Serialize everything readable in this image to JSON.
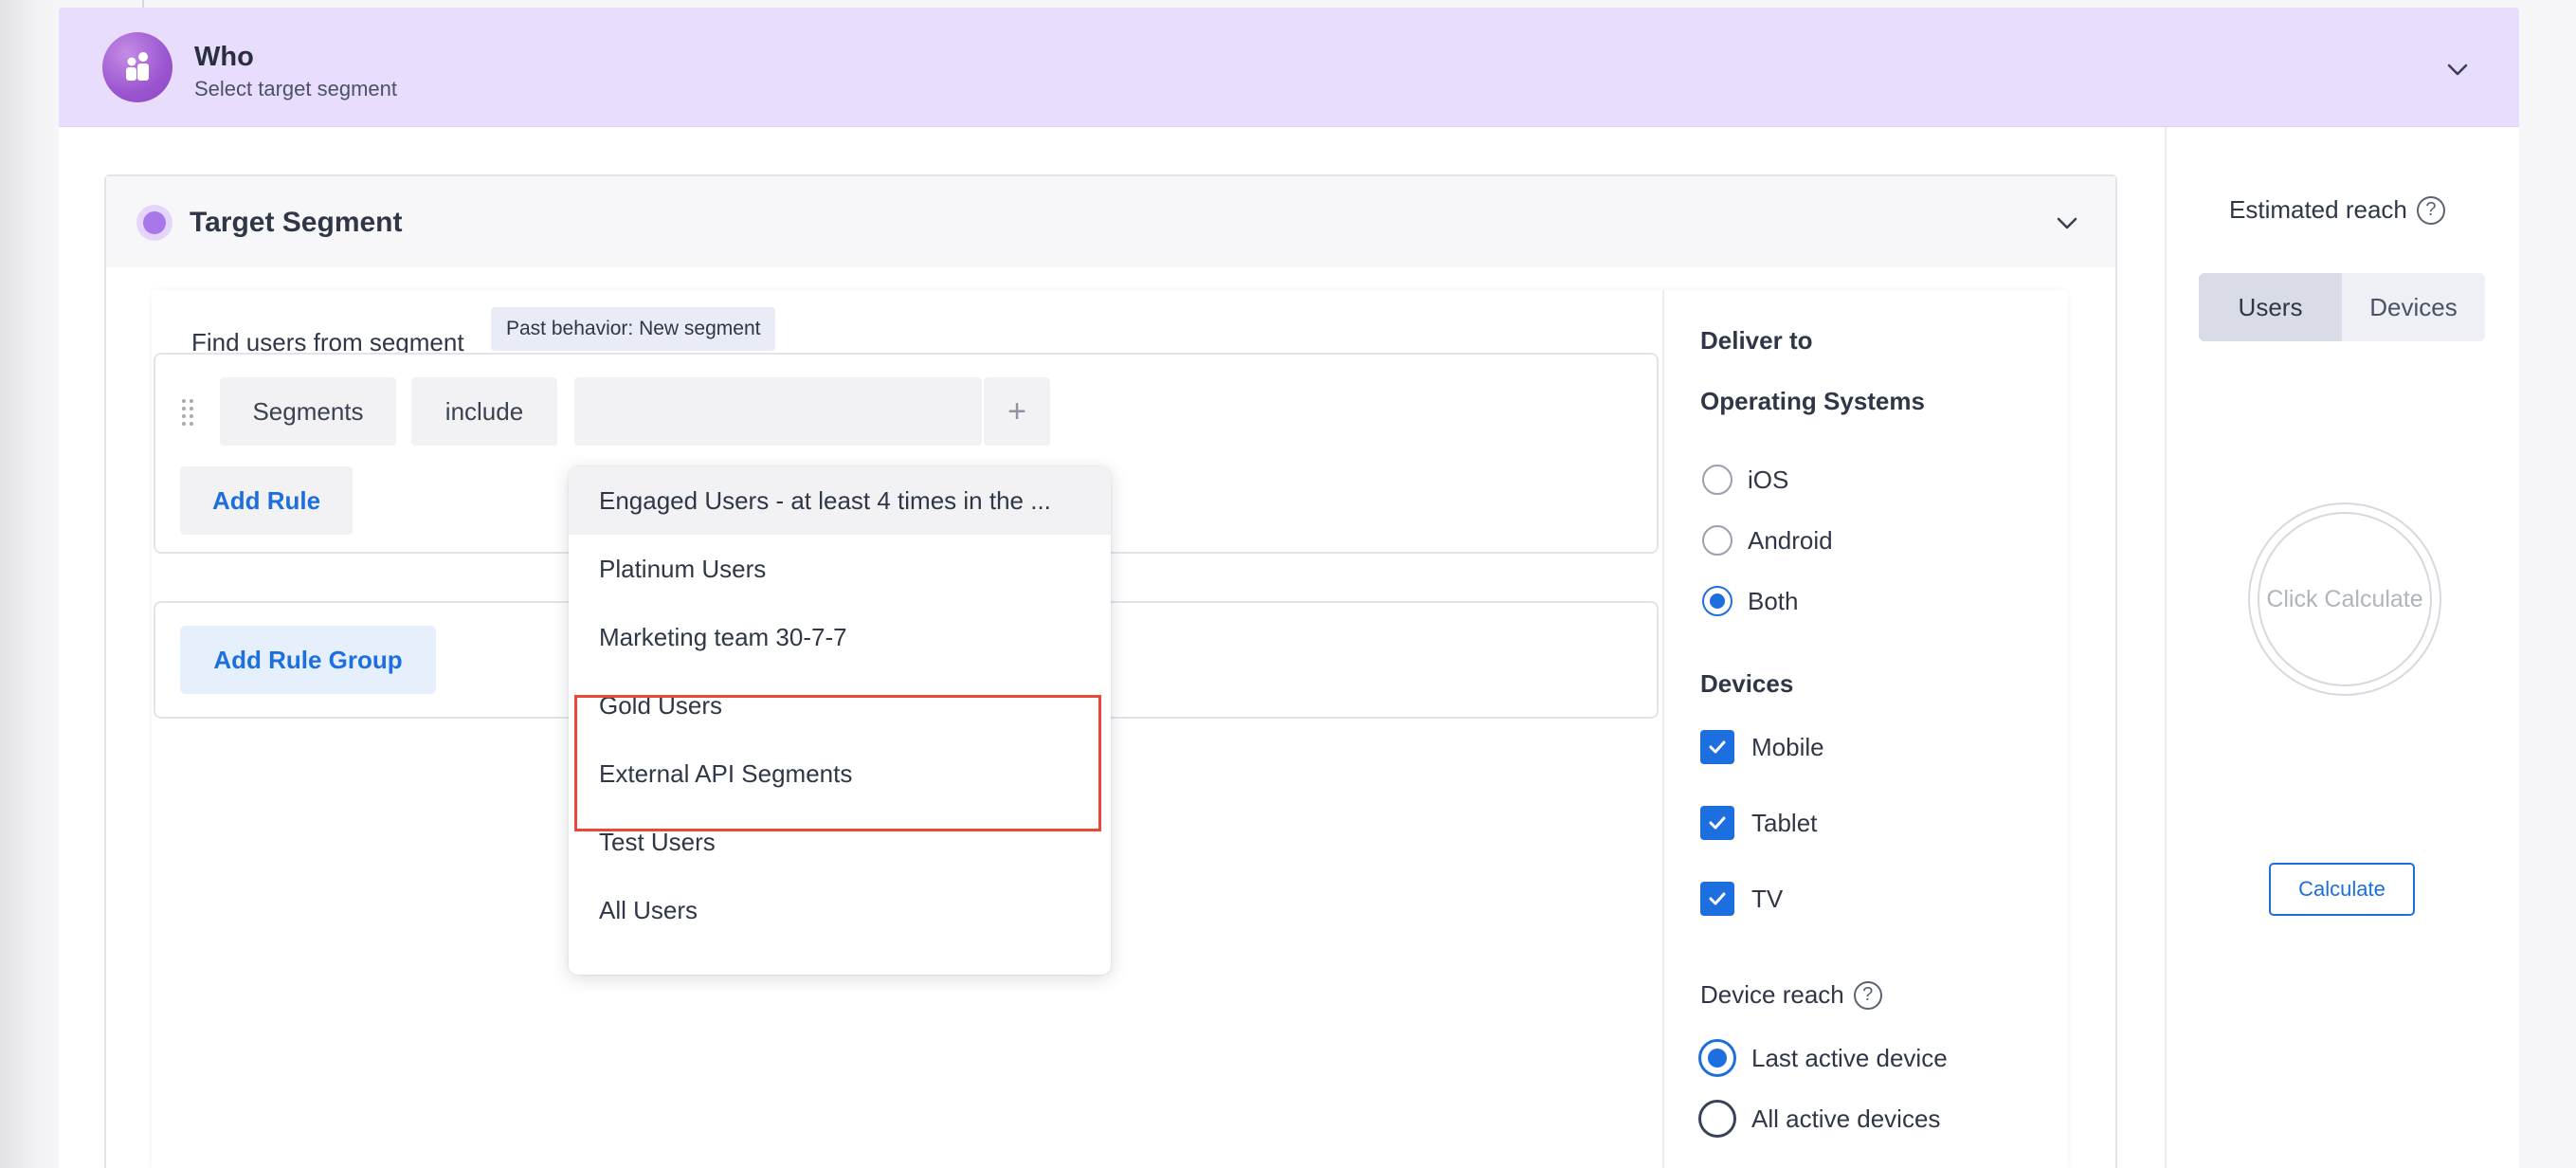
{
  "who": {
    "title": "Who",
    "subtitle": "Select target segment"
  },
  "target_segment": {
    "title": "Target Segment",
    "find_label": "Find users from segment",
    "segment_tag": "Past behavior: New segment",
    "rule": {
      "field": "Segments",
      "operator": "include",
      "value": "",
      "plus": "+"
    },
    "add_rule_label": "Add Rule",
    "add_rule_group_label": "Add Rule Group"
  },
  "dropdown": {
    "items": [
      "Engaged Users - at least 4 times in the ...",
      "Platinum Users",
      "Marketing team 30-7-7",
      "Gold Users",
      "External API Segments",
      "Test Users",
      "All Users"
    ],
    "hovered_index": 0,
    "highlighted_indices": [
      3,
      4
    ],
    "highlight_color": "#e8473a"
  },
  "deliver": {
    "title": "Deliver to",
    "os_title": "Operating Systems",
    "os_options": [
      {
        "label": "iOS",
        "selected": false
      },
      {
        "label": "Android",
        "selected": false
      },
      {
        "label": "Both",
        "selected": true
      }
    ],
    "devices_title": "Devices",
    "devices": [
      {
        "label": "Mobile",
        "checked": true
      },
      {
        "label": "Tablet",
        "checked": true
      },
      {
        "label": "TV",
        "checked": true
      }
    ],
    "device_reach_title": "Device reach",
    "device_reach_options": [
      {
        "label": "Last active device",
        "selected": true
      },
      {
        "label": "All active devices",
        "selected": false
      }
    ]
  },
  "reach": {
    "title": "Estimated reach",
    "toggle": [
      "Users",
      "Devices"
    ],
    "active_toggle": "Users",
    "circle_text": "Click Calculate",
    "calculate_label": "Calculate"
  },
  "colors": {
    "accent": "#1d6fe0",
    "header_bg": "#e8ddfd",
    "avatar": "#9b55cf"
  }
}
